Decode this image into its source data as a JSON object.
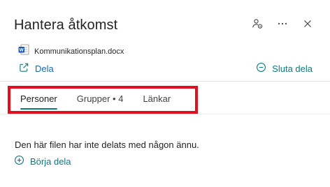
{
  "panel": {
    "title": "Hantera åtkomst"
  },
  "file": {
    "name": "Kommunikationsplan.docx",
    "icon": "word-document-icon"
  },
  "actions": {
    "share_label": "Dela",
    "stop_sharing_label": "Sluta dela"
  },
  "tabs": [
    {
      "label": "Personer",
      "active": true
    },
    {
      "label": "Grupper • 4",
      "active": false
    },
    {
      "label": "Länkar",
      "active": false
    }
  ],
  "content": {
    "empty_message": "Den här filen har inte delats med någon ännu.",
    "start_sharing_label": "Börja dela"
  },
  "colors": {
    "link_blue": "#0f6cbd",
    "teal": "#0e7a80",
    "highlight_red": "#e2101f",
    "word_blue": "#185abd"
  }
}
